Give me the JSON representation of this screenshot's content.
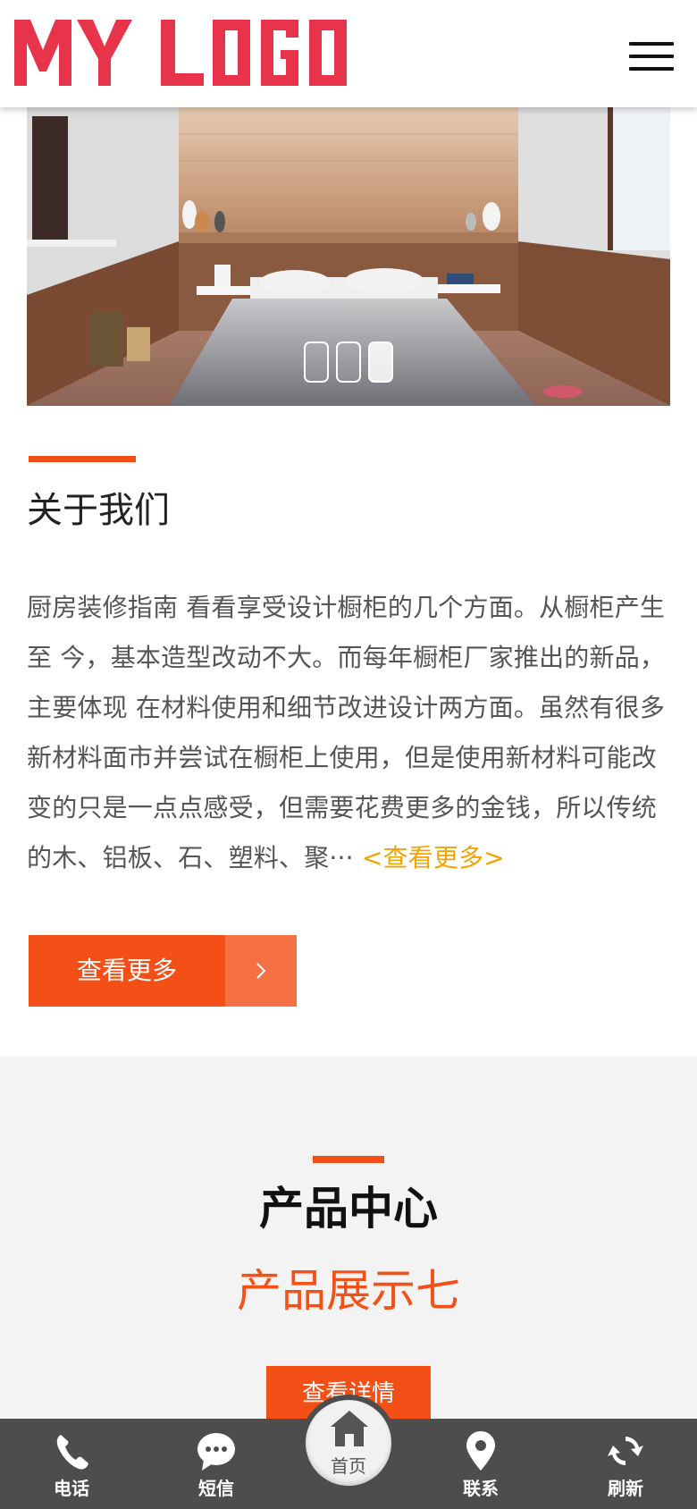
{
  "header": {
    "logo_text": "MY LOGO",
    "logo_color": "#e8344a",
    "menu_icon": "hamburger-menu-icon"
  },
  "banner": {
    "description_icon": "bedroom-photo",
    "slides": 3,
    "active_slide": 3
  },
  "about": {
    "title": "关于我们",
    "text": "厨房装修指南 看看享受设计橱柜的几个方面。从橱柜产生至 今，基本造型改动不大。而每年橱柜厂家推出的新品，主要体现 在材料使用和细节改进设计两方面。虽然有很多新材料面市并尝试在橱柜上使用，但是使用新材料可能改变的只是一点点感受，但需要花费更多的金钱，所以传统的木、铝板、石、塑料、聚··· ",
    "inline_more": "<查看更多>",
    "button_label": "查看更多",
    "button_icon": "chevron-right-icon"
  },
  "products": {
    "title": "产品中心",
    "subtitle": "产品展示七",
    "detail_button": "查看详情"
  },
  "bottom_nav": {
    "phone": "电话",
    "sms": "短信",
    "home": "首页",
    "contact": "联系",
    "refresh": "刷新"
  },
  "colors": {
    "accent": "#f34f17",
    "link": "#f4a300",
    "nav_bg": "#4d4d4d"
  }
}
